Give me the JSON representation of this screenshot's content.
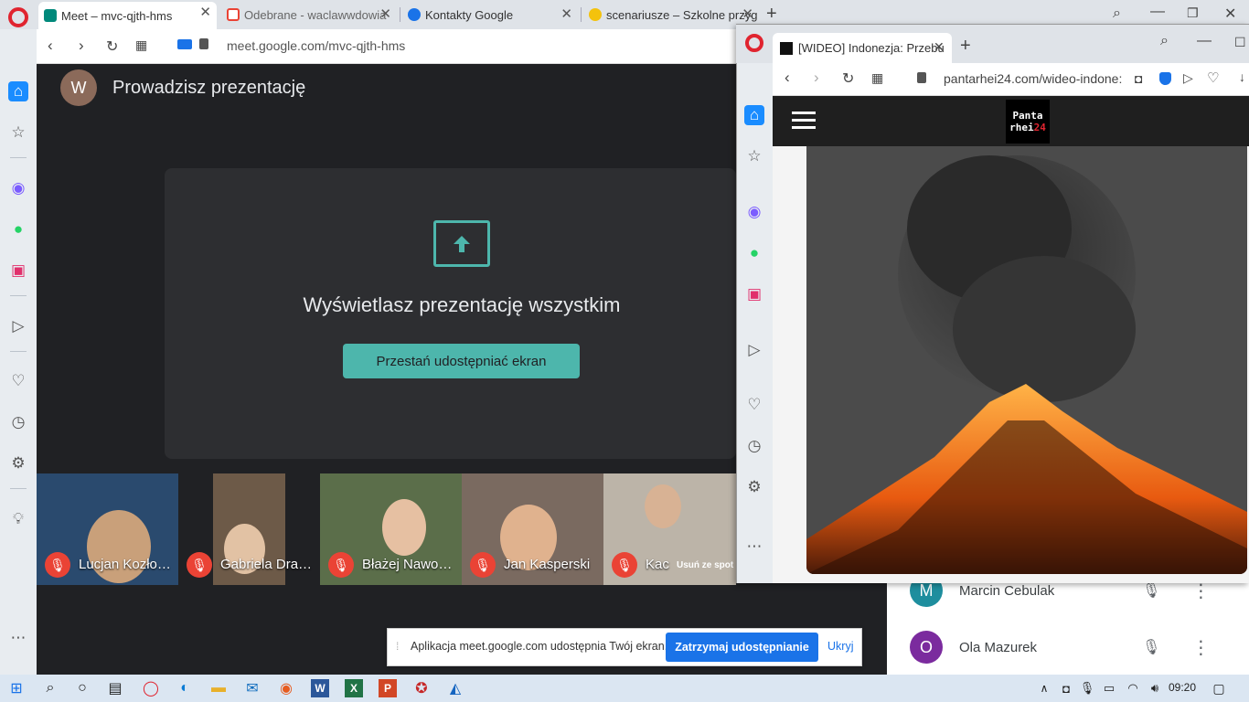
{
  "main_browser": {
    "tabs": [
      {
        "label": "Meet – mvc-qjth-hms",
        "active": true,
        "icon": "meet-icon"
      },
      {
        "label": "Odebrane - waclawwdowia",
        "active": false,
        "icon": "gmail-icon"
      },
      {
        "label": "Kontakty Google",
        "active": false,
        "icon": "contacts-icon"
      },
      {
        "label": "scenariusze – Szkolne przyg",
        "active": false,
        "icon": "emoji-icon"
      }
    ],
    "url": "meet.google.com/mvc-qjth-hms"
  },
  "meet": {
    "avatar_letter": "W",
    "presenting_title": "Prowadzisz prezentację",
    "present_text": "Wyświetlasz prezentację wszystkim",
    "stop_button": "Przestań udostępniać ekran",
    "participants": [
      {
        "name": "Lucjan Kozło…"
      },
      {
        "name": "Gabriela Dra…"
      },
      {
        "name": "Błażej Nawo…"
      },
      {
        "name": "Jan Kasperski"
      },
      {
        "name": "Kac"
      }
    ],
    "remove_hint": "Usuń ze spot",
    "people": [
      {
        "letter": "M",
        "name": "Marcin Cebulak",
        "color": "#1e8e9e"
      },
      {
        "letter": "O",
        "name": "Ola Mazurek",
        "color": "#7b2b9e"
      }
    ]
  },
  "share_bar": {
    "text": "Aplikacja meet.google.com udostępnia Twój ekran.",
    "stop": "Zatrzymaj udostępnianie",
    "hide": "Ukryj"
  },
  "second_browser": {
    "tab_label": "[WIDEO] Indonezja: Przebu",
    "url": "pantarhei24.com/wideo-indone:",
    "logo_line1": "Panta",
    "logo_line2": "rhei",
    "logo_line2_accent": "24"
  },
  "taskbar": {
    "time": "09:20"
  },
  "colors": {
    "meet_bg": "#202124",
    "accent_teal": "#4db6ac",
    "google_blue": "#1a73e8",
    "opera_red": "#e0242f"
  }
}
